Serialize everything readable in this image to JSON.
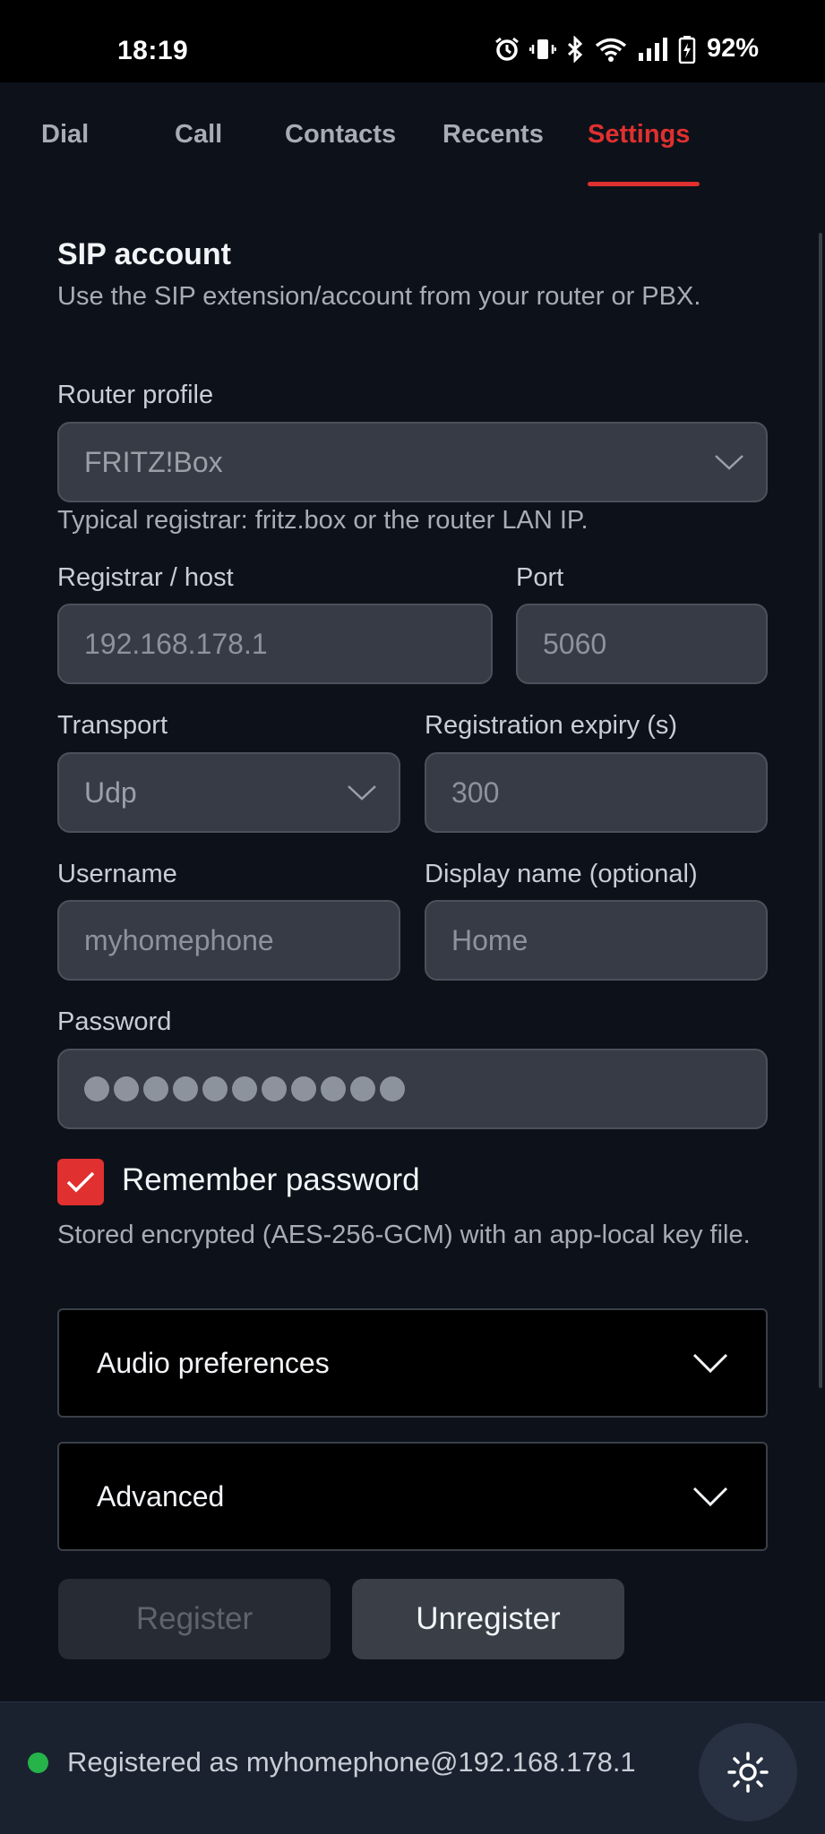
{
  "status_bar": {
    "time": "18:19",
    "battery_percent": "92%",
    "icons": [
      "alarm-icon",
      "vibrate-icon",
      "bluetooth-icon",
      "wifi-icon",
      "signal-icon",
      "battery-icon"
    ]
  },
  "tabs": [
    {
      "label": "Dial",
      "active": false
    },
    {
      "label": "Call",
      "active": false
    },
    {
      "label": "Contacts",
      "active": false
    },
    {
      "label": "Recents",
      "active": false
    },
    {
      "label": "Settings",
      "active": true
    }
  ],
  "accent_color": "#e0302f",
  "sip": {
    "title": "SIP account",
    "description": "Use the SIP extension/account from your router or PBX.",
    "router_profile": {
      "label": "Router profile",
      "value": "FRITZ!Box",
      "hint": "Typical registrar: fritz.box or the router LAN IP."
    },
    "registrar": {
      "label": "Registrar / host",
      "placeholder": "192.168.178.1"
    },
    "port": {
      "label": "Port",
      "placeholder": "5060"
    },
    "transport": {
      "label": "Transport",
      "value": "Udp"
    },
    "expiry": {
      "label": "Registration expiry (s)",
      "placeholder": "300"
    },
    "username": {
      "label": "Username",
      "placeholder": "myhomephone"
    },
    "display_name": {
      "label": "Display name (optional)",
      "placeholder": "Home"
    },
    "password": {
      "label": "Password",
      "masked_length": 11
    },
    "remember": {
      "label": "Remember password",
      "checked": true
    },
    "storage_note": "Stored encrypted (AES-256-GCM) with an app-local key file."
  },
  "accordions": {
    "audio": "Audio preferences",
    "advanced": "Advanced"
  },
  "buttons": {
    "register": "Register",
    "unregister": "Unregister"
  },
  "footer": {
    "status": "Registered as myhomephone@192.168.178.1",
    "status_color": "#26b34a"
  }
}
